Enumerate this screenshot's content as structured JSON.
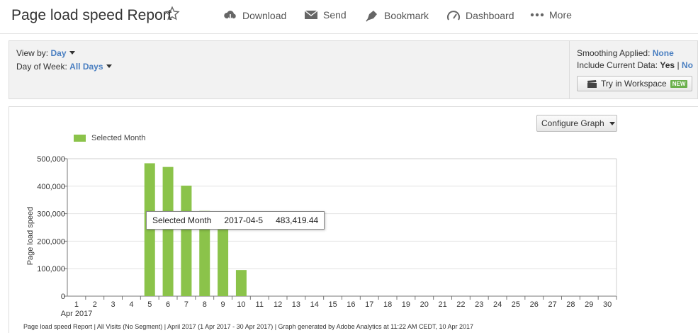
{
  "header": {
    "title": "Page load speed Report",
    "actions": [
      {
        "label": "Download",
        "icon": "cloud-download-icon"
      },
      {
        "label": "Send",
        "icon": "envelope-icon"
      },
      {
        "label": "Bookmark",
        "icon": "bookmark-icon"
      },
      {
        "label": "Dashboard",
        "icon": "gauge-icon"
      },
      {
        "label": "More",
        "icon": "more-dots-icon"
      }
    ]
  },
  "settings": {
    "view_by_label": "View by:",
    "view_by_value": "Day",
    "day_of_week_label": "Day of Week:",
    "day_of_week_value": "All Days",
    "smoothing_label": "Smoothing Applied:",
    "smoothing_value": "None",
    "include_label": "Include Current Data:",
    "include_yes": "Yes",
    "include_sep": "|",
    "include_no": "No",
    "workspace_button": "Try in Workspace",
    "new_badge": "NEW"
  },
  "graph": {
    "configure_button": "Configure Graph",
    "tooltip": {
      "series": "Selected Month",
      "date": "2017-04-5",
      "value": "483,419.44"
    },
    "footer": "Page load speed Report | All Visits (No Segment) | April 2017 (1 Apr 2017 - 30 Apr 2017) | Graph generated by Adobe Analytics at 11:22 AM CEDT, 10 Apr 2017"
  },
  "chart_data": {
    "type": "bar",
    "categories": [
      "1",
      "2",
      "3",
      "4",
      "5",
      "6",
      "7",
      "8",
      "9",
      "10",
      "11",
      "12",
      "13",
      "14",
      "15",
      "16",
      "17",
      "18",
      "19",
      "20",
      "21",
      "22",
      "23",
      "24",
      "25",
      "26",
      "27",
      "28",
      "29",
      "30"
    ],
    "series": [
      {
        "name": "Selected Month",
        "color": "#8bc34a",
        "values": [
          0,
          0,
          0,
          0,
          483419.44,
          470000,
          402000,
          310000,
          300000,
          95000,
          0,
          0,
          0,
          0,
          0,
          0,
          0,
          0,
          0,
          0,
          0,
          0,
          0,
          0,
          0,
          0,
          0,
          0,
          0,
          0
        ]
      }
    ],
    "x_sublabel": "Apr 2017",
    "ylabel": "Page load speed",
    "ylim": [
      0,
      500000
    ],
    "yticks": [
      0,
      100000,
      200000,
      300000,
      400000,
      500000
    ],
    "ytick_labels": [
      "0",
      "100,000",
      "200,000",
      "300,000",
      "400,000",
      "500,000"
    ],
    "grid": true,
    "legend": "top-left"
  }
}
